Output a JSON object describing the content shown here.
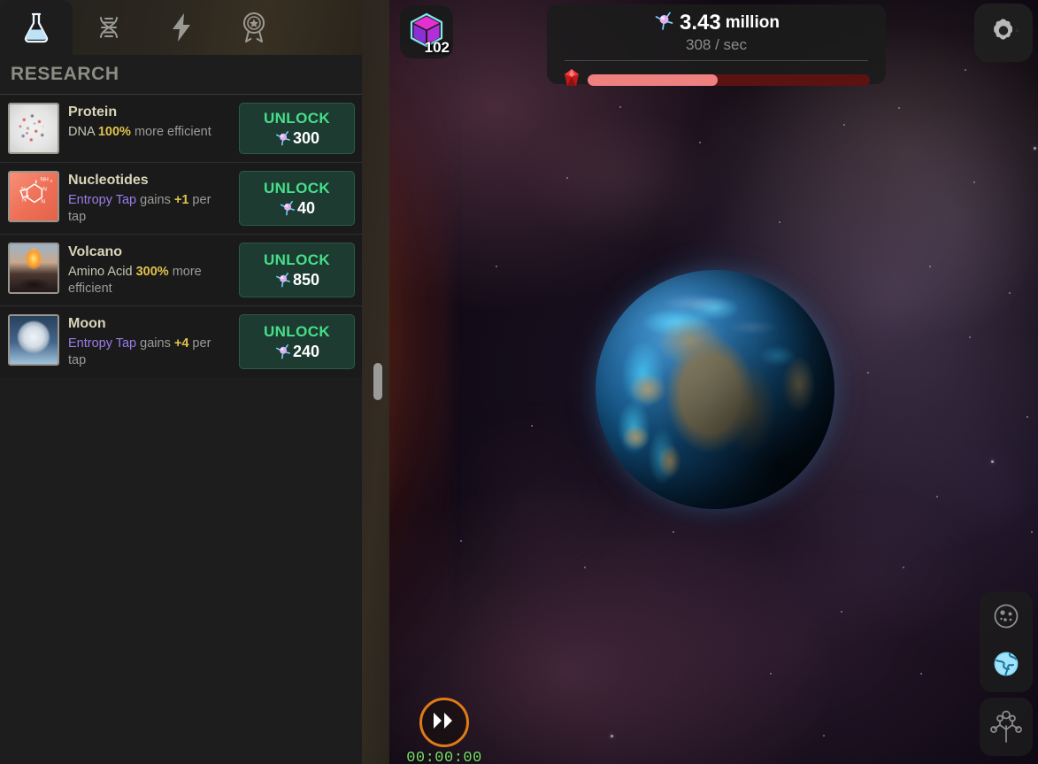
{
  "sidebar": {
    "tabs": [
      {
        "name": "research",
        "icon": "flask-icon",
        "active": true
      },
      {
        "name": "dna",
        "icon": "dna-helix-icon",
        "active": false
      },
      {
        "name": "energy",
        "icon": "lightning-bolt-icon",
        "active": false
      },
      {
        "name": "achievements",
        "icon": "medal-icon",
        "active": false
      }
    ],
    "panel_title": "RESEARCH",
    "items": [
      {
        "name": "Protein",
        "icon": "protein-molecule-thumb",
        "desc_parts": [
          {
            "text": "DNA ",
            "style": "white"
          },
          {
            "text": "100%",
            "style": "yellow"
          },
          {
            "text": " more efficient",
            "style": "grey"
          }
        ],
        "unlock_label": "UNLOCK",
        "price": "300",
        "price_icon": "entropy-icon"
      },
      {
        "name": "Nucleotides",
        "icon": "nucleotide-thumb",
        "desc_parts": [
          {
            "text": "Entropy Tap",
            "style": "purple"
          },
          {
            "text": " gains ",
            "style": "grey"
          },
          {
            "text": "+1",
            "style": "yellow"
          },
          {
            "text": " per tap",
            "style": "grey"
          }
        ],
        "unlock_label": "UNLOCK",
        "price": "40",
        "price_icon": "entropy-icon"
      },
      {
        "name": "Volcano",
        "icon": "volcano-thumb",
        "desc_parts": [
          {
            "text": "Amino Acid ",
            "style": "white"
          },
          {
            "text": " 300%",
            "style": "yellow"
          },
          {
            "text": " more efficient",
            "style": "grey"
          }
        ],
        "unlock_label": "UNLOCK",
        "price": "850",
        "price_icon": "entropy-icon"
      },
      {
        "name": "Moon",
        "icon": "moon-thumb",
        "desc_parts": [
          {
            "text": "Entropy Tap",
            "style": "purple"
          },
          {
            "text": " gains ",
            "style": "grey"
          },
          {
            "text": "+4",
            "style": "yellow"
          },
          {
            "text": " per tap",
            "style": "grey"
          }
        ],
        "unlock_label": "UNLOCK",
        "price": "240",
        "price_icon": "entropy-icon"
      }
    ]
  },
  "hud": {
    "cube": {
      "icon": "cube-icon",
      "count": "102"
    },
    "entropy": {
      "icon": "entropy-icon",
      "amount": "3.43",
      "unit": "million",
      "rate": "308 / sec"
    },
    "progress": {
      "icon": "red-gem-icon",
      "percent": 46,
      "fill_color": "#ef8080",
      "track_color": "#5b1212"
    },
    "settings_icon": "gear-icon"
  },
  "right_buttons": [
    {
      "name": "cell-view-button",
      "icon": "cell-icon",
      "active": false
    },
    {
      "name": "planet-view-button",
      "icon": "globe-icon",
      "active": true
    },
    {
      "name": "tech-tree-button",
      "icon": "tech-tree-icon",
      "active": false
    }
  ],
  "timer": {
    "fast_forward_icon": "fast-forward-icon",
    "value": "00:00:00",
    "accent": "#e07b18",
    "text_color": "#79e36a"
  },
  "scene": {
    "sun": "star-sun",
    "planet": "earth-like-planet",
    "background": "purple-nebula-starfield"
  }
}
